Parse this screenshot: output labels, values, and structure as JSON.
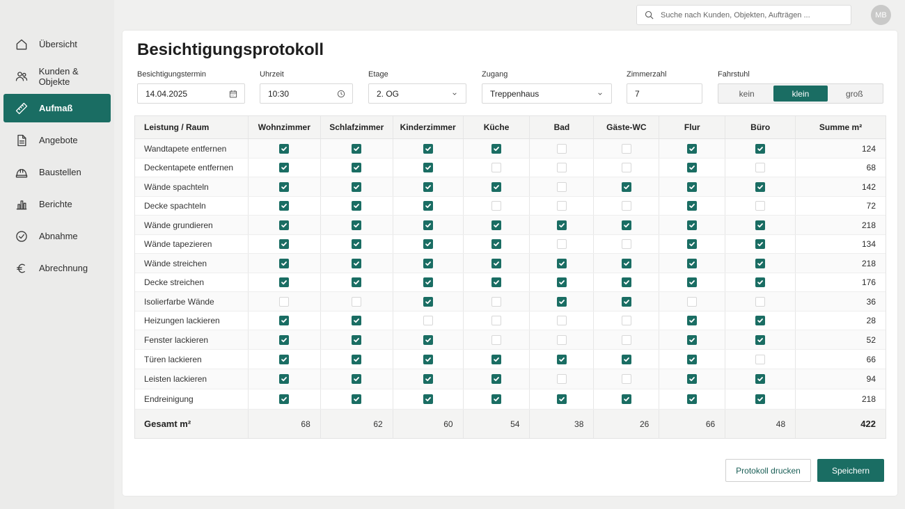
{
  "nav": {
    "items": [
      {
        "label": "Übersicht",
        "icon": "home-icon"
      },
      {
        "label": "Kunden & Objekte",
        "icon": "users-icon"
      },
      {
        "label": "Aufmaß",
        "icon": "ruler-icon",
        "active": true
      },
      {
        "label": "Angebote",
        "icon": "document-icon"
      },
      {
        "label": "Baustellen",
        "icon": "hardhat-icon"
      },
      {
        "label": "Berichte",
        "icon": "bar-chart-icon"
      },
      {
        "label": "Abnahme",
        "icon": "check-circle-icon"
      },
      {
        "label": "Abrechnung",
        "icon": "euro-icon"
      }
    ]
  },
  "search": {
    "placeholder": "Suche nach Kunden, Objekten, Aufträgen ..."
  },
  "user": {
    "initials": "MB"
  },
  "page": {
    "title": "Besichtigungsprotokoll"
  },
  "form": {
    "date": {
      "label": "Besichtigungstermin",
      "value": "14.04.2025"
    },
    "time": {
      "label": "Uhrzeit",
      "value": "10:30"
    },
    "floor": {
      "label": "Etage",
      "value": "2. OG"
    },
    "access": {
      "label": "Zugang",
      "value": "Treppenhaus"
    },
    "rooms": {
      "label": "Zimmerzahl",
      "value": "7"
    },
    "elevator": {
      "label": "Fahrstuhl",
      "options": [
        "kein",
        "klein",
        "groß"
      ],
      "selected": "klein"
    }
  },
  "table": {
    "headers": [
      "Leistung / Raum",
      "Wohnzimmer",
      "Schlafzimmer",
      "Kinderzimmer",
      "Küche",
      "Bad",
      "Gäste-WC",
      "Flur",
      "Büro",
      "Summe m²"
    ],
    "rows": [
      {
        "label": "Wandtapete entfernen",
        "checks": [
          1,
          1,
          1,
          1,
          0,
          0,
          1,
          1
        ],
        "sum": "124"
      },
      {
        "label": "Deckentapete entfernen",
        "checks": [
          1,
          1,
          1,
          0,
          0,
          0,
          1,
          0
        ],
        "sum": "68"
      },
      {
        "label": "Wände spachteln",
        "checks": [
          1,
          1,
          1,
          1,
          0,
          1,
          1,
          1
        ],
        "sum": "142"
      },
      {
        "label": "Decke spachteln",
        "checks": [
          1,
          1,
          1,
          0,
          0,
          0,
          1,
          0
        ],
        "sum": "72"
      },
      {
        "label": "Wände grundieren",
        "checks": [
          1,
          1,
          1,
          1,
          1,
          1,
          1,
          1
        ],
        "sum": "218"
      },
      {
        "label": "Wände tapezieren",
        "checks": [
          1,
          1,
          1,
          1,
          0,
          0,
          1,
          1
        ],
        "sum": "134"
      },
      {
        "label": "Wände streichen",
        "checks": [
          1,
          1,
          1,
          1,
          1,
          1,
          1,
          1
        ],
        "sum": "218"
      },
      {
        "label": "Decke streichen",
        "checks": [
          1,
          1,
          1,
          1,
          1,
          1,
          1,
          1
        ],
        "sum": "176"
      },
      {
        "label": "Isolierfarbe Wände",
        "checks": [
          0,
          0,
          1,
          0,
          1,
          1,
          0,
          0
        ],
        "sum": "36"
      },
      {
        "label": "Heizungen lackieren",
        "checks": [
          1,
          1,
          0,
          0,
          0,
          0,
          1,
          1
        ],
        "sum": "28"
      },
      {
        "label": "Fenster lackieren",
        "checks": [
          1,
          1,
          1,
          0,
          0,
          0,
          1,
          1
        ],
        "sum": "52"
      },
      {
        "label": "Türen lackieren",
        "checks": [
          1,
          1,
          1,
          1,
          1,
          1,
          1,
          0
        ],
        "sum": "66"
      },
      {
        "label": "Leisten lackieren",
        "checks": [
          1,
          1,
          1,
          1,
          0,
          0,
          1,
          1
        ],
        "sum": "94"
      },
      {
        "label": "Endreinigung",
        "checks": [
          1,
          1,
          1,
          1,
          1,
          1,
          1,
          1
        ],
        "sum": "218"
      }
    ],
    "footer": {
      "label": "Gesamt m²",
      "values": [
        "68",
        "62",
        "60",
        "54",
        "38",
        "26",
        "66",
        "48"
      ],
      "total": "422"
    }
  },
  "actions": {
    "print_label": "Protokoll drucken",
    "save_label": "Speichern"
  },
  "colors": {
    "accent": "#1a6d63"
  }
}
